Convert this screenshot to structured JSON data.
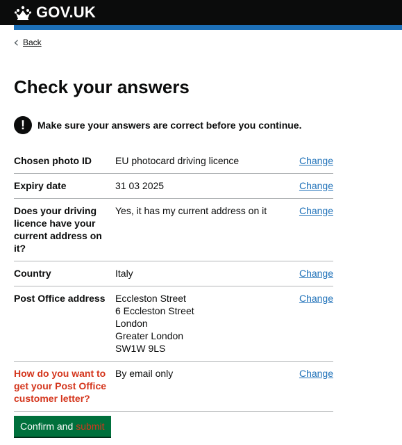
{
  "header": {
    "logo_text": "GOV.UK"
  },
  "nav": {
    "back_label": "Back"
  },
  "page": {
    "title": "Check your answers",
    "warning_icon_glyph": "!",
    "warning": "Make sure your answers are correct before you continue."
  },
  "summary": {
    "rows": [
      {
        "key": "Chosen photo ID",
        "values": [
          "EU photocard driving licence"
        ],
        "action": "Change"
      },
      {
        "key": "Expiry date",
        "values": [
          "31 03 2025"
        ],
        "action": "Change"
      },
      {
        "key": "Does your driving licence have your current address on it?",
        "values": [
          "Yes, it has my current address on it"
        ],
        "action": "Change"
      },
      {
        "key": "Country",
        "values": [
          "Italy"
        ],
        "action": "Change"
      },
      {
        "key": "Post Office address",
        "values": [
          "Eccleston Street",
          "6 Eccleston Street",
          "London",
          "Greater London",
          "SW1W 9LS"
        ],
        "action": "Change"
      },
      {
        "key": "How do you want to get your Post Office customer letter?",
        "values": [
          "By email only"
        ],
        "action": "Change"
      }
    ]
  },
  "button": {
    "label_part1": "Confirm and",
    "label_part2": "submit"
  },
  "colors": {
    "header": "#0b0c0c",
    "brand_blue": "#1d70b8",
    "link": "#1d70b8",
    "error_red": "#d4351c",
    "button_green": "#00703c",
    "divider": "#b1b4b6"
  },
  "icons": [
    "crown-icon",
    "chevron-left-icon",
    "warning-icon"
  ]
}
